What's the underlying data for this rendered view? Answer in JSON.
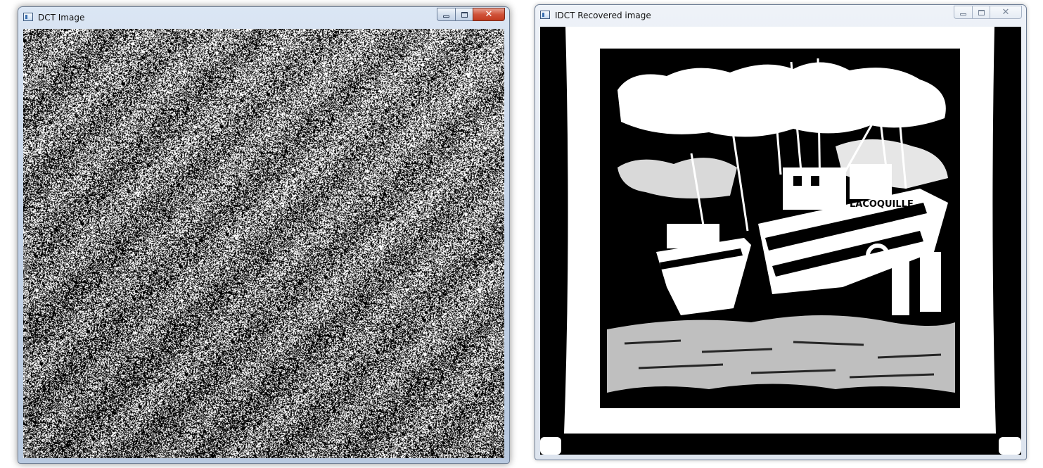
{
  "windows": {
    "dct": {
      "title": "DCT Image",
      "controls": {
        "minimize": "minimize",
        "maximize": "maximize",
        "close": "close"
      },
      "content": "dct-noise-image"
    },
    "idct": {
      "title": "IDCT Recovered image",
      "controls": {
        "minimize": "minimize",
        "maximize": "maximize",
        "close": "close"
      },
      "content": "binary-boats-image"
    }
  },
  "colors": {
    "titlebar_active": "#c7d6ea",
    "titlebar_inactive": "#e3e9f2",
    "close_active": "#c23a1f"
  }
}
